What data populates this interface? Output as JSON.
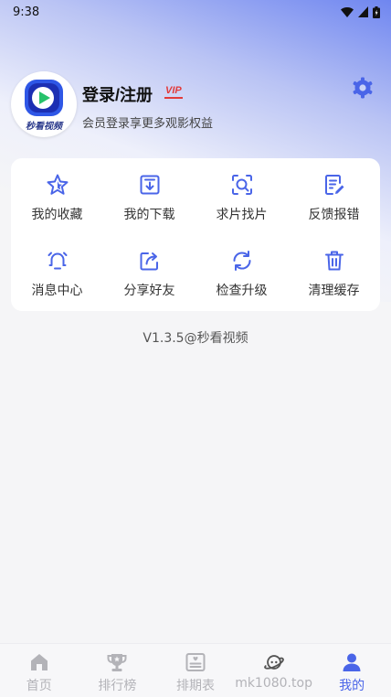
{
  "status_bar": {
    "time": "9:38"
  },
  "profile": {
    "avatar_tag": "秒看视频",
    "login_title": "登录/注册",
    "vip_badge": "VIP",
    "subtitle": "会员登录享更多观影权益",
    "settings_icon": "gear-icon"
  },
  "menu": {
    "items": [
      {
        "label": "我的收藏",
        "icon": "star-icon"
      },
      {
        "label": "我的下载",
        "icon": "download-icon"
      },
      {
        "label": "求片找片",
        "icon": "search-scan-icon"
      },
      {
        "label": "反馈报错",
        "icon": "feedback-edit-icon"
      },
      {
        "label": "消息中心",
        "icon": "bell-icon"
      },
      {
        "label": "分享好友",
        "icon": "share-icon"
      },
      {
        "label": "检查升级",
        "icon": "refresh-icon"
      },
      {
        "label": "清理缓存",
        "icon": "trash-icon"
      }
    ]
  },
  "version": "V1.3.5@秒看视频",
  "tabbar": {
    "tabs": [
      {
        "label": "首页",
        "icon": "home-icon"
      },
      {
        "label": "排行榜",
        "icon": "trophy-icon"
      },
      {
        "label": "排期表",
        "icon": "schedule-icon"
      },
      {
        "label": "mk1080.top",
        "icon": "planet-icon"
      },
      {
        "label": "我的",
        "icon": "user-icon"
      }
    ],
    "active_tab": "我的"
  },
  "colors": {
    "accent": "#4a65e8",
    "vip": "#e23b3b",
    "tab_inactive": "#b3b3b8"
  }
}
